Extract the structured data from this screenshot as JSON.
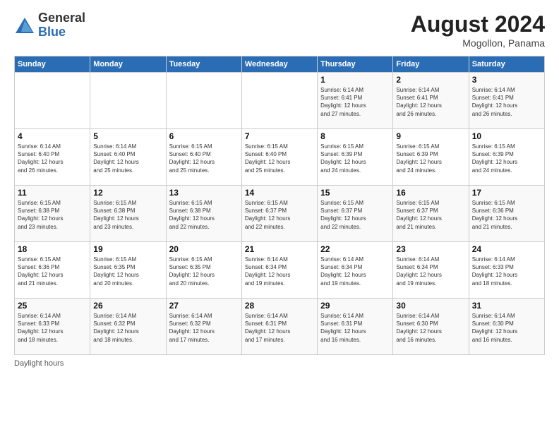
{
  "header": {
    "logo_general": "General",
    "logo_blue": "Blue",
    "main_title": "August 2024",
    "subtitle": "Mogollon, Panama"
  },
  "footer": {
    "label": "Daylight hours"
  },
  "calendar": {
    "days_of_week": [
      "Sunday",
      "Monday",
      "Tuesday",
      "Wednesday",
      "Thursday",
      "Friday",
      "Saturday"
    ],
    "weeks": [
      [
        {
          "day": "",
          "info": ""
        },
        {
          "day": "",
          "info": ""
        },
        {
          "day": "",
          "info": ""
        },
        {
          "day": "",
          "info": ""
        },
        {
          "day": "1",
          "info": "Sunrise: 6:14 AM\nSunset: 6:41 PM\nDaylight: 12 hours\nand 27 minutes."
        },
        {
          "day": "2",
          "info": "Sunrise: 6:14 AM\nSunset: 6:41 PM\nDaylight: 12 hours\nand 26 minutes."
        },
        {
          "day": "3",
          "info": "Sunrise: 6:14 AM\nSunset: 6:41 PM\nDaylight: 12 hours\nand 26 minutes."
        }
      ],
      [
        {
          "day": "4",
          "info": "Sunrise: 6:14 AM\nSunset: 6:40 PM\nDaylight: 12 hours\nand 26 minutes."
        },
        {
          "day": "5",
          "info": "Sunrise: 6:14 AM\nSunset: 6:40 PM\nDaylight: 12 hours\nand 25 minutes."
        },
        {
          "day": "6",
          "info": "Sunrise: 6:15 AM\nSunset: 6:40 PM\nDaylight: 12 hours\nand 25 minutes."
        },
        {
          "day": "7",
          "info": "Sunrise: 6:15 AM\nSunset: 6:40 PM\nDaylight: 12 hours\nand 25 minutes."
        },
        {
          "day": "8",
          "info": "Sunrise: 6:15 AM\nSunset: 6:39 PM\nDaylight: 12 hours\nand 24 minutes."
        },
        {
          "day": "9",
          "info": "Sunrise: 6:15 AM\nSunset: 6:39 PM\nDaylight: 12 hours\nand 24 minutes."
        },
        {
          "day": "10",
          "info": "Sunrise: 6:15 AM\nSunset: 6:39 PM\nDaylight: 12 hours\nand 24 minutes."
        }
      ],
      [
        {
          "day": "11",
          "info": "Sunrise: 6:15 AM\nSunset: 6:38 PM\nDaylight: 12 hours\nand 23 minutes."
        },
        {
          "day": "12",
          "info": "Sunrise: 6:15 AM\nSunset: 6:38 PM\nDaylight: 12 hours\nand 23 minutes."
        },
        {
          "day": "13",
          "info": "Sunrise: 6:15 AM\nSunset: 6:38 PM\nDaylight: 12 hours\nand 22 minutes."
        },
        {
          "day": "14",
          "info": "Sunrise: 6:15 AM\nSunset: 6:37 PM\nDaylight: 12 hours\nand 22 minutes."
        },
        {
          "day": "15",
          "info": "Sunrise: 6:15 AM\nSunset: 6:37 PM\nDaylight: 12 hours\nand 22 minutes."
        },
        {
          "day": "16",
          "info": "Sunrise: 6:15 AM\nSunset: 6:37 PM\nDaylight: 12 hours\nand 21 minutes."
        },
        {
          "day": "17",
          "info": "Sunrise: 6:15 AM\nSunset: 6:36 PM\nDaylight: 12 hours\nand 21 minutes."
        }
      ],
      [
        {
          "day": "18",
          "info": "Sunrise: 6:15 AM\nSunset: 6:36 PM\nDaylight: 12 hours\nand 21 minutes."
        },
        {
          "day": "19",
          "info": "Sunrise: 6:15 AM\nSunset: 6:35 PM\nDaylight: 12 hours\nand 20 minutes."
        },
        {
          "day": "20",
          "info": "Sunrise: 6:15 AM\nSunset: 6:35 PM\nDaylight: 12 hours\nand 20 minutes."
        },
        {
          "day": "21",
          "info": "Sunrise: 6:14 AM\nSunset: 6:34 PM\nDaylight: 12 hours\nand 19 minutes."
        },
        {
          "day": "22",
          "info": "Sunrise: 6:14 AM\nSunset: 6:34 PM\nDaylight: 12 hours\nand 19 minutes."
        },
        {
          "day": "23",
          "info": "Sunrise: 6:14 AM\nSunset: 6:34 PM\nDaylight: 12 hours\nand 19 minutes."
        },
        {
          "day": "24",
          "info": "Sunrise: 6:14 AM\nSunset: 6:33 PM\nDaylight: 12 hours\nand 18 minutes."
        }
      ],
      [
        {
          "day": "25",
          "info": "Sunrise: 6:14 AM\nSunset: 6:33 PM\nDaylight: 12 hours\nand 18 minutes."
        },
        {
          "day": "26",
          "info": "Sunrise: 6:14 AM\nSunset: 6:32 PM\nDaylight: 12 hours\nand 18 minutes."
        },
        {
          "day": "27",
          "info": "Sunrise: 6:14 AM\nSunset: 6:32 PM\nDaylight: 12 hours\nand 17 minutes."
        },
        {
          "day": "28",
          "info": "Sunrise: 6:14 AM\nSunset: 6:31 PM\nDaylight: 12 hours\nand 17 minutes."
        },
        {
          "day": "29",
          "info": "Sunrise: 6:14 AM\nSunset: 6:31 PM\nDaylight: 12 hours\nand 16 minutes."
        },
        {
          "day": "30",
          "info": "Sunrise: 6:14 AM\nSunset: 6:30 PM\nDaylight: 12 hours\nand 16 minutes."
        },
        {
          "day": "31",
          "info": "Sunrise: 6:14 AM\nSunset: 6:30 PM\nDaylight: 12 hours\nand 16 minutes."
        }
      ]
    ]
  }
}
